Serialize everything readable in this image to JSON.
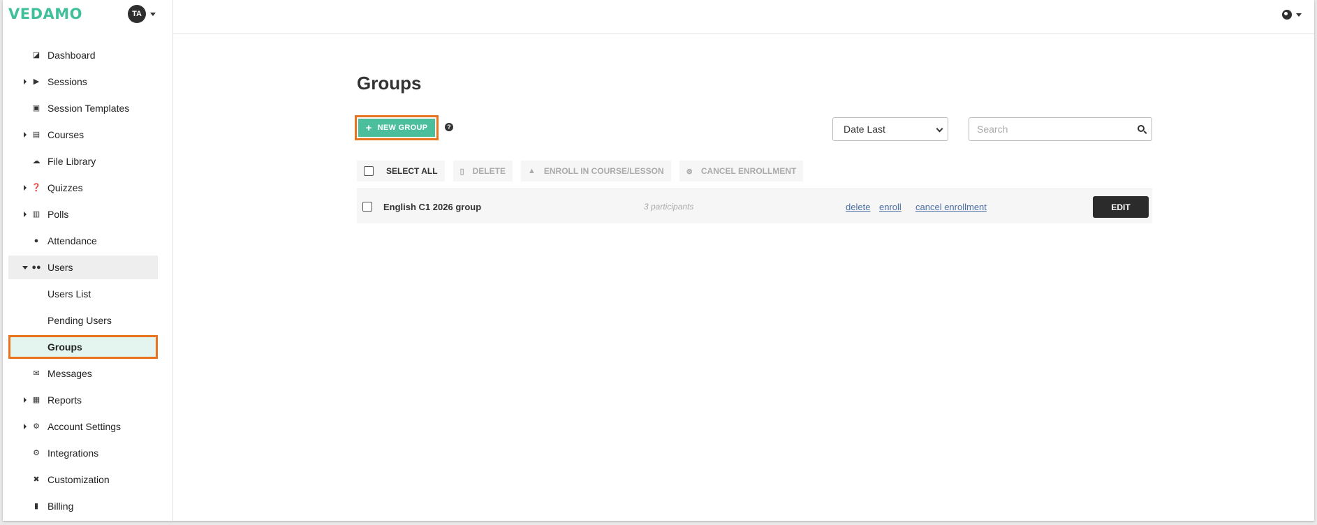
{
  "brand": {
    "logo_text": "VEDAMO",
    "accent": "#4bbf9b",
    "highlight": "#e8731f"
  },
  "user": {
    "initials": "TA"
  },
  "sidebar": {
    "items": [
      {
        "label": "Dashboard",
        "icon": "dashboard-icon",
        "expandable": false
      },
      {
        "label": "Sessions",
        "icon": "play-circle-icon",
        "expandable": true
      },
      {
        "label": "Session Templates",
        "icon": "template-icon",
        "expandable": false
      },
      {
        "label": "Courses",
        "icon": "book-icon",
        "expandable": true
      },
      {
        "label": "File Library",
        "icon": "cloud-upload-icon",
        "expandable": false
      },
      {
        "label": "Quizzes",
        "icon": "question-circle-icon",
        "expandable": true
      },
      {
        "label": "Polls",
        "icon": "bar-chart-icon",
        "expandable": true
      },
      {
        "label": "Attendance",
        "icon": "user-check-icon",
        "expandable": false
      },
      {
        "label": "Users",
        "icon": "users-icon",
        "expandable": true,
        "expanded": true
      },
      {
        "label": "Users List",
        "sub": true
      },
      {
        "label": "Pending Users",
        "sub": true
      },
      {
        "label": "Groups",
        "sub": true,
        "selected": true
      },
      {
        "label": "Messages",
        "icon": "envelope-icon",
        "expandable": false
      },
      {
        "label": "Reports",
        "icon": "report-icon",
        "expandable": true
      },
      {
        "label": "Account Settings",
        "icon": "gear-icon",
        "expandable": true
      },
      {
        "label": "Integrations",
        "icon": "cogs-icon",
        "expandable": false
      },
      {
        "label": "Customization",
        "icon": "tools-icon",
        "expandable": false
      },
      {
        "label": "Billing",
        "icon": "file-invoice-icon",
        "expandable": false
      }
    ]
  },
  "main": {
    "title": "Groups",
    "new_group_label": "NEW GROUP",
    "help_label": "?",
    "sort": {
      "selected": "Date Last"
    },
    "search": {
      "placeholder": "Search"
    },
    "toolbar": {
      "select_all": "SELECT ALL",
      "delete": "DELETE",
      "enroll": "ENROLL IN COURSE/LESSON",
      "cancel_enrollment": "CANCEL ENROLLMENT"
    },
    "groups": [
      {
        "name": "English C1 2026 group",
        "participants": "3 participants",
        "links": {
          "delete": "delete",
          "enroll": "enroll",
          "cancel": "cancel enrollment"
        },
        "edit_label": "EDIT"
      }
    ]
  }
}
